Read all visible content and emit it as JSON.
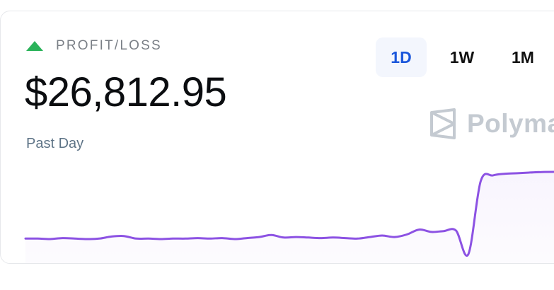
{
  "widget": {
    "label": "PROFIT/LOSS",
    "amount": "$26,812.95",
    "period": "Past Day",
    "trend": "up",
    "trend_color": "#2bb35a"
  },
  "tabs": [
    {
      "label": "1D",
      "active": true
    },
    {
      "label": "1W",
      "active": false
    },
    {
      "label": "1M",
      "active": false
    }
  ],
  "brand": {
    "name": "Polyma",
    "icon": "polymarket-logo-icon"
  },
  "chart_data": {
    "type": "area",
    "line_color": "#8c52e3",
    "grid": false,
    "x": [
      0,
      1,
      2,
      3,
      4,
      5,
      6,
      7,
      8,
      9,
      10,
      11,
      12,
      13,
      14,
      15,
      16,
      17,
      18,
      19,
      20,
      21,
      22,
      23,
      24,
      25,
      26,
      27,
      28,
      29,
      30,
      31,
      32,
      33,
      34,
      35,
      36,
      37,
      38,
      39,
      40,
      41,
      42,
      43,
      44
    ],
    "values": [
      0.3,
      0.3,
      0.0,
      0.6,
      0.3,
      0.0,
      0.3,
      1.5,
      1.8,
      0.3,
      0.3,
      0.0,
      0.3,
      0.3,
      0.6,
      0.3,
      0.6,
      0.0,
      0.6,
      1.2,
      2.4,
      0.9,
      1.2,
      0.9,
      0.6,
      0.9,
      0.6,
      0.3,
      1.2,
      2.1,
      1.2,
      2.7,
      5.6,
      4.2,
      4.7,
      5.0,
      -8.9,
      34.0,
      37.5,
      38.5,
      38.8,
      39.2,
      39.5,
      39.6,
      39.7
    ],
    "ylim": [
      -10,
      40
    ]
  }
}
